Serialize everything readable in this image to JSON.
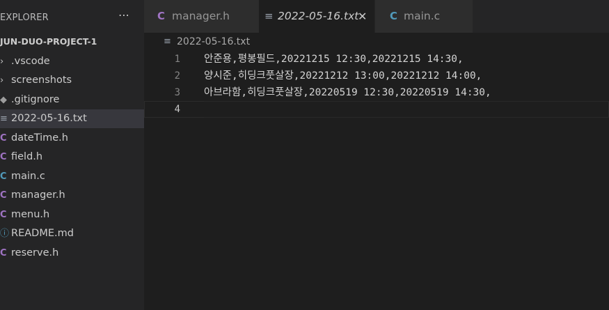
{
  "explorer": {
    "title": "EXPLORER",
    "more_icon": "⋯",
    "project": "JUN-DUO-PROJECT-1",
    "items": [
      {
        "label": ".vscode",
        "icon": "chevron-right",
        "glyph": "›"
      },
      {
        "label": "screenshots",
        "icon": "chevron-right",
        "glyph": "›"
      },
      {
        "label": ".gitignore",
        "icon": "git",
        "glyph": "◆"
      },
      {
        "label": "2022-05-16.txt",
        "icon": "text-lines",
        "glyph": "≡"
      },
      {
        "label": "dateTime.h",
        "icon": "c-header",
        "glyph": "C"
      },
      {
        "label": "field.h",
        "icon": "c-header",
        "glyph": "C"
      },
      {
        "label": "main.c",
        "icon": "c-source",
        "glyph": "C"
      },
      {
        "label": "manager.h",
        "icon": "c-header",
        "glyph": "C"
      },
      {
        "label": "menu.h",
        "icon": "c-header",
        "glyph": "C"
      },
      {
        "label": "README.md",
        "icon": "info",
        "glyph": "ⓘ"
      },
      {
        "label": "reserve.h",
        "icon": "c-header",
        "glyph": "C"
      }
    ]
  },
  "tabs": [
    {
      "label": "manager.h",
      "icon": "c-header",
      "glyph": "C"
    },
    {
      "label": "2022-05-16.txt",
      "icon": "text-lines",
      "glyph": "≡",
      "close": "✕"
    },
    {
      "label": "main.c",
      "icon": "c-source",
      "glyph": "C"
    }
  ],
  "breadcrumb": {
    "label": "2022-05-16.txt",
    "glyph": "≡"
  },
  "editor": {
    "lines": [
      {
        "num": "1",
        "text": "안준용,평봉필드,20221215 12:30,20221215 14:30,"
      },
      {
        "num": "2",
        "text": "양시준,히딩크풋살장,20221212 13:00,20221212 14:00,"
      },
      {
        "num": "3",
        "text": "아브라함,히딩크풋살장,20220519 12:30,20220519 14:30,"
      },
      {
        "num": "4",
        "text": ""
      }
    ]
  },
  "colors": {
    "c_header": "#a074c4",
    "c_source": "#519aba",
    "selected": "#37373d"
  }
}
